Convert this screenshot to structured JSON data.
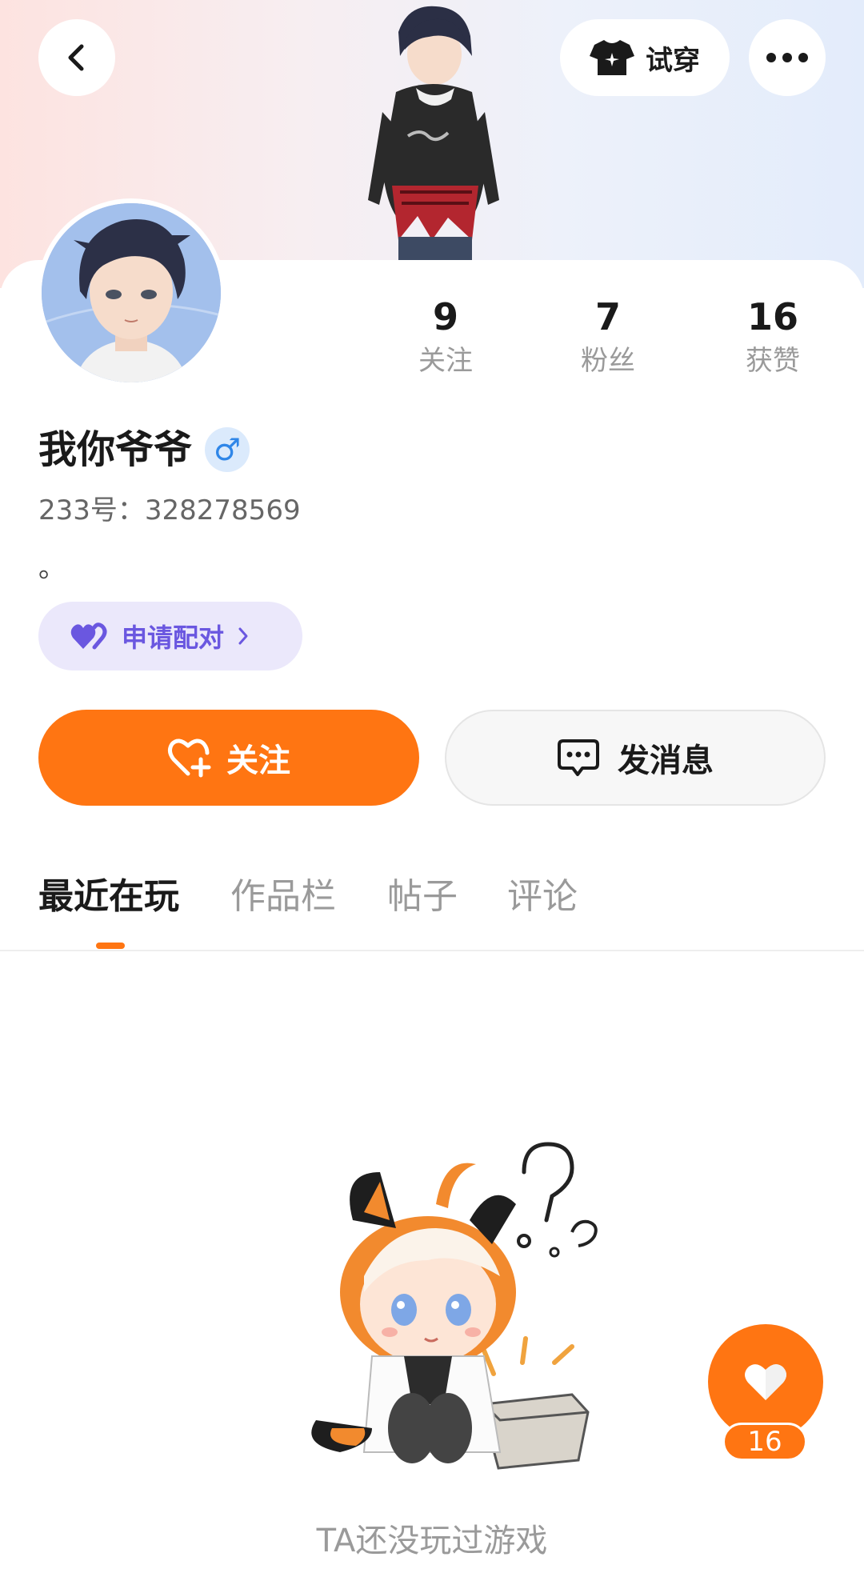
{
  "header": {
    "tryon_label": "试穿",
    "icons": {
      "back": "chevron-left-icon",
      "tryon": "tshirt-icon",
      "more": "more-horizontal-icon"
    }
  },
  "profile": {
    "username": "我你爷爷",
    "gender_symbol": "♂",
    "user_id": "233号：328278569",
    "bio": "。",
    "stats": [
      {
        "value": "9",
        "label": "关注"
      },
      {
        "value": "7",
        "label": "粉丝"
      },
      {
        "value": "16",
        "label": "获赞"
      }
    ]
  },
  "actions": {
    "match_label": "申请配对",
    "follow_label": "关注",
    "message_label": "发消息"
  },
  "tabs": [
    {
      "label": "最近在玩",
      "active": true
    },
    {
      "label": "作品栏",
      "active": false
    },
    {
      "label": "帖子",
      "active": false
    },
    {
      "label": "评论",
      "active": false
    }
  ],
  "empty_state": {
    "text": "TA还没玩过游戏"
  },
  "like_fab": {
    "count": "16"
  },
  "colors": {
    "accent": "#ff7512",
    "match_purple": "#6a57e0",
    "match_bg": "#ebe8fb",
    "gender_blue": "#2f86e8"
  }
}
